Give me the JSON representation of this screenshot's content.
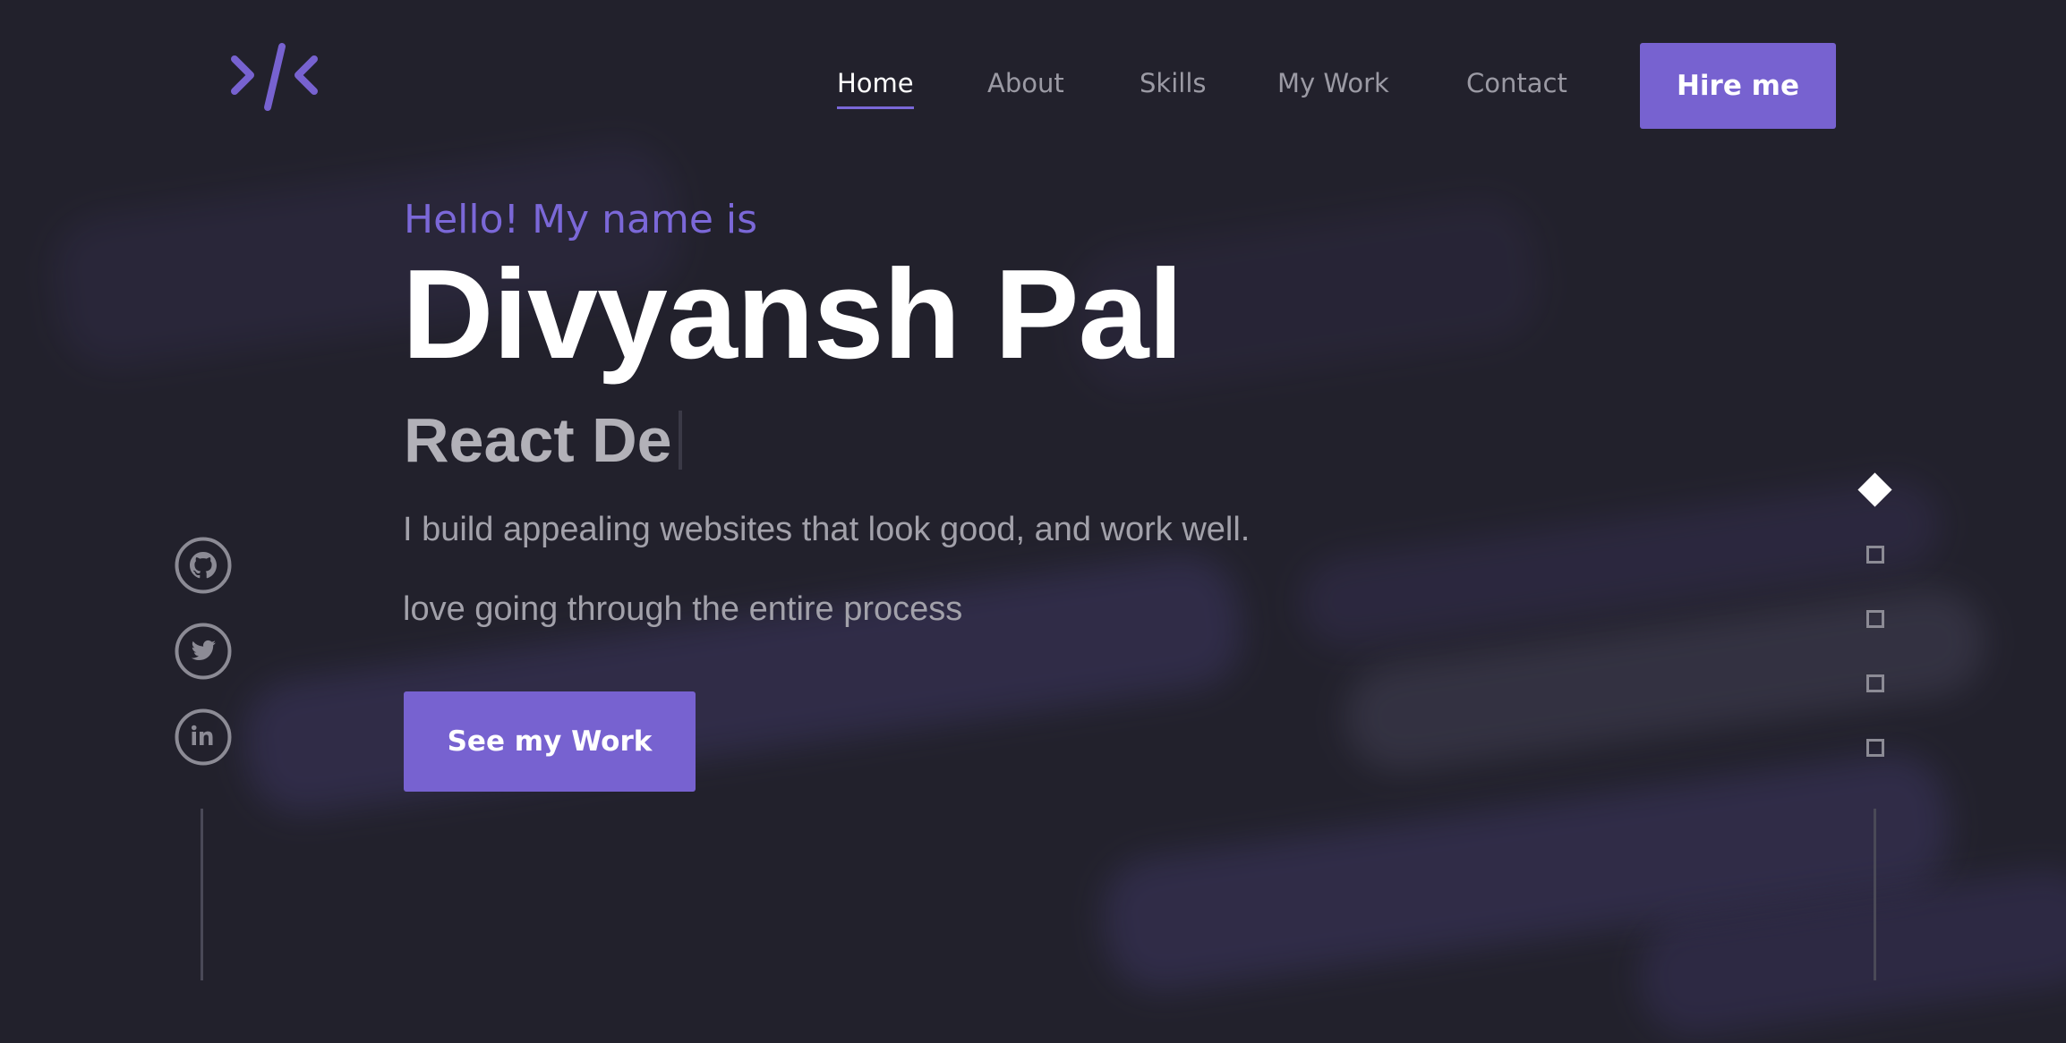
{
  "nav": {
    "items": [
      {
        "label": "Home",
        "active": true
      },
      {
        "label": "About",
        "active": false
      },
      {
        "label": "Skills",
        "active": false
      },
      {
        "label": "My Work",
        "active": false
      },
      {
        "label": "Contact",
        "active": false
      }
    ],
    "hire_label": "Hire me"
  },
  "logo": {
    "icon": "code-slash-icon"
  },
  "hero": {
    "greeting": "Hello! My name is",
    "name": "Divyansh Pal",
    "role_typed": "React De",
    "tagline_1": "I build appealing websites that look good, and work well.",
    "tagline_2": "love going through the entire process",
    "cta_label": "See my Work"
  },
  "social": [
    {
      "icon": "github-icon"
    },
    {
      "icon": "twitter-icon"
    },
    {
      "icon": "linkedin-icon"
    }
  ],
  "section_indicators": {
    "count": 5,
    "active_index": 0
  },
  "colors": {
    "background": "#22212c",
    "accent": "#7762d0",
    "accent_text": "#7b68d8",
    "muted_text": "#a2a1aa"
  }
}
